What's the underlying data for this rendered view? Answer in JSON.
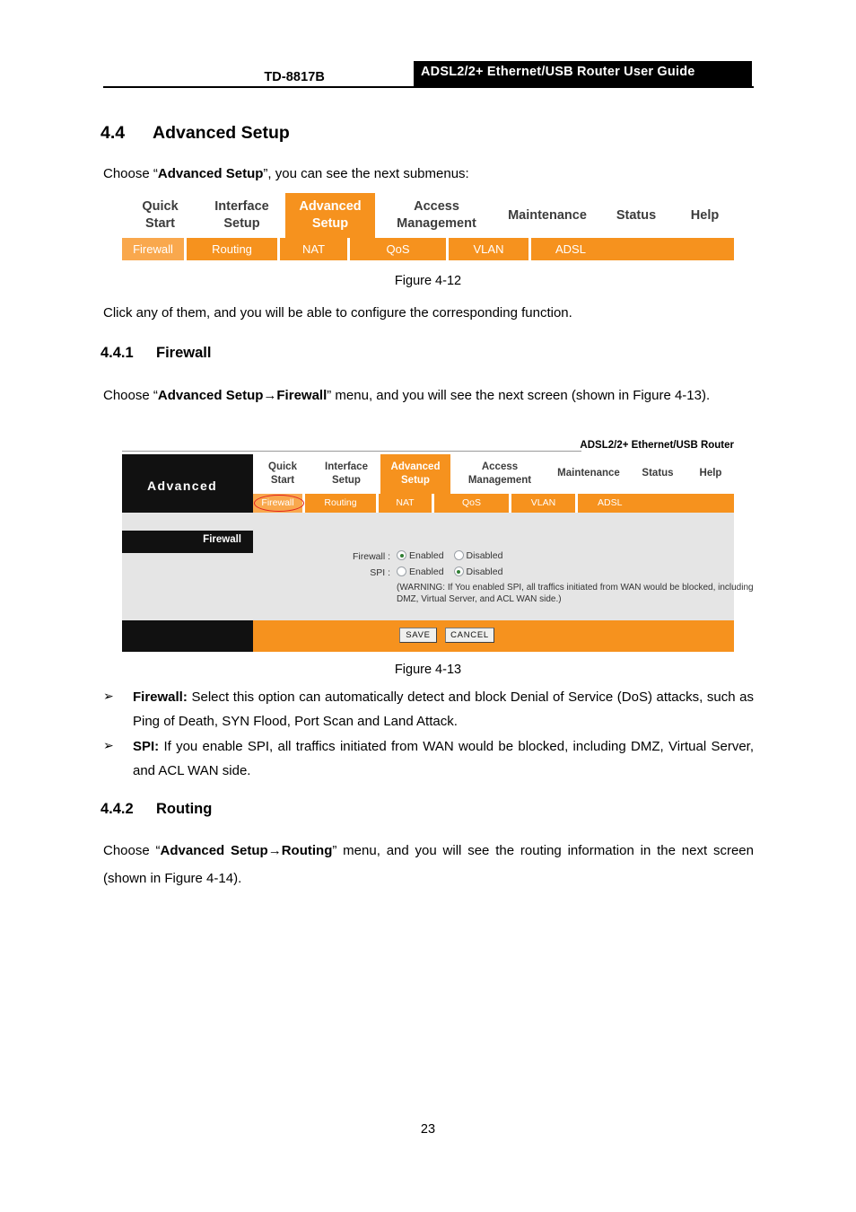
{
  "header": {
    "model": "TD-8817B",
    "title": "ADSL2/2+ Ethernet/USB Router User Guide"
  },
  "section": {
    "number": "4.4",
    "title": "Advanced Setup",
    "intro_1": "Choose “",
    "intro_1_bold": "Advanced Setup",
    "intro_1_end": "”, you can see the next submenus:",
    "after_fig12": "Click any of them, and you will be able to configure the corresponding function."
  },
  "fig12": {
    "caption": "Figure 4-12",
    "main_tabs": [
      {
        "label": "Quick\nStart",
        "line1": "Quick",
        "line2": "Start",
        "active": false
      },
      {
        "label": "Interface\nSetup",
        "line1": "Interface",
        "line2": "Setup",
        "active": false
      },
      {
        "label": "Advanced\nSetup",
        "line1": "Advanced",
        "line2": "Setup",
        "active": true
      },
      {
        "label": "Access\nManagement",
        "line1": "Access",
        "line2": "Management",
        "active": false
      },
      {
        "label": "Maintenance",
        "line1": "Maintenance",
        "line2": "",
        "active": false
      },
      {
        "label": "Status",
        "line1": "Status",
        "line2": "",
        "active": false
      },
      {
        "label": "Help",
        "line1": "Help",
        "line2": "",
        "active": false
      }
    ],
    "sub_tabs": [
      "Firewall",
      "Routing",
      "NAT",
      "QoS",
      "VLAN",
      "ADSL"
    ]
  },
  "subsection_441": {
    "number": "4.4.1",
    "title": "Firewall",
    "para_pre": "Choose “",
    "para_bold": "Advanced Setup→Firewall",
    "para_post": "” menu, and you will see the next screen (shown in Figure 4-13)."
  },
  "fig13": {
    "caption": "Figure 4-13",
    "product_name": "ADSL2/2+ Ethernet/USB Router",
    "logo_label": "Advanced",
    "main_tabs": [
      {
        "line1": "Quick",
        "line2": "Start",
        "active": false
      },
      {
        "line1": "Interface",
        "line2": "Setup",
        "active": false
      },
      {
        "line1": "Advanced",
        "line2": "Setup",
        "active": true
      },
      {
        "line1": "Access",
        "line2": "Management",
        "active": false
      },
      {
        "line1": "Maintenance",
        "line2": "",
        "active": false
      },
      {
        "line1": "Status",
        "line2": "",
        "active": false
      },
      {
        "line1": "Help",
        "line2": "",
        "active": false
      }
    ],
    "sub_tabs": [
      "Firewall",
      "Routing",
      "NAT",
      "QoS",
      "VLAN",
      "ADSL"
    ],
    "selected_sub_tab": "Firewall",
    "sidebar_title": "Firewall",
    "form": {
      "firewall_label": "Firewall :",
      "firewall_enabled": "Enabled",
      "firewall_disabled": "Disabled",
      "firewall_value": "Enabled",
      "spi_label": "SPI :",
      "spi_enabled": "Enabled",
      "spi_disabled": "Disabled",
      "spi_value": "Disabled",
      "warning": "(WARNING: If You enabled SPI, all traffics initiated from WAN would be blocked, including DMZ, Virtual Server, and ACL WAN side.)"
    },
    "buttons": {
      "save": "SAVE",
      "cancel": "CANCEL"
    },
    "accent_color": "#f6921e",
    "annotation_color": "#e02020"
  },
  "bullets": [
    {
      "marker": "➢",
      "term": "Firewall:",
      "text": " Select this option can automatically detect and block Denial of Service (DoS) attacks, such as Ping of Death, SYN Flood, Port Scan and Land Attack."
    },
    {
      "marker": "➢",
      "term": "SPI:",
      "text": " If you enable SPI, all traffics initiated from WAN would be blocked, including DMZ, Virtual Server, and ACL WAN side."
    }
  ],
  "subsection_442": {
    "number": "4.4.2",
    "title": "Routing",
    "para_pre": "Choose “",
    "para_bold": "Advanced Setup→Routing",
    "para_post": "” menu, and you will see the routing information in the next screen (shown in Figure 4-14)."
  },
  "page_number": "23"
}
